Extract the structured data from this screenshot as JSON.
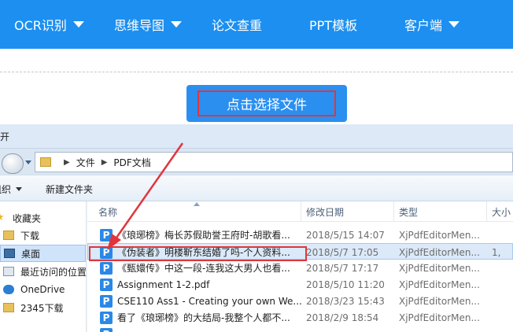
{
  "nav": {
    "items": [
      {
        "label": "OCR识别",
        "dropdown": true
      },
      {
        "label": "思维导图",
        "dropdown": true
      },
      {
        "label": "论文查重",
        "dropdown": false
      },
      {
        "label": "PPT模板",
        "dropdown": false
      },
      {
        "label": "客户端",
        "dropdown": true
      }
    ],
    "color": "#1c8ff0"
  },
  "upload": {
    "button_label": "点击选择文件",
    "highlight_color": "#e0363b"
  },
  "dialog": {
    "title": "打开",
    "address": {
      "root": "文件",
      "folder": "PDF文档"
    },
    "toolbar": {
      "organize": "组织",
      "new_folder": "新建文件夹"
    },
    "nav_pane": [
      {
        "label": "收藏夹",
        "icon": "star-icon"
      },
      {
        "label": "下载",
        "icon": "folder-icon"
      },
      {
        "label": "桌面",
        "icon": "desktop-icon",
        "selected": true
      },
      {
        "label": "最近访问的位置",
        "icon": "recent-icon"
      },
      {
        "label": "OneDrive",
        "icon": "cloud-icon"
      },
      {
        "label": "2345下载",
        "icon": "folder-icon"
      }
    ],
    "columns": {
      "name": "名称",
      "date": "修改日期",
      "type": "类型",
      "size": "大小"
    },
    "files": [
      {
        "name": "《琅琊榜》梅长苏假助誉王府时-胡歌看...",
        "date": "2018/5/15 14:07",
        "type": "XjPdfEditorMen...",
        "size": ""
      },
      {
        "name": "《伪装者》明楼靳东结婚了吗-个人资料...",
        "date": "2018/5/7 17:05",
        "type": "XjPdfEditorMen...",
        "size": "1,",
        "selected": true
      },
      {
        "name": "《甄嬛传》中这一段-连我这大男人也看...",
        "date": "2018/5/7 17:17",
        "type": "XjPdfEditorMen...",
        "size": ""
      },
      {
        "name": "Assignment 1-2.pdf",
        "date": "2018/5/10 11:20",
        "type": "XjPdfEditorMen...",
        "size": ""
      },
      {
        "name": "CSE110 Ass1 - Creating your own We...",
        "date": "2018/3/23 15:43",
        "type": "XjPdfEditorMen...",
        "size": ""
      },
      {
        "name": "看了《琅琊榜》的大结局-我整个人都不...",
        "date": "2018/2/9 18:54",
        "type": "XjPdfEditorMen...",
        "size": ""
      }
    ]
  }
}
